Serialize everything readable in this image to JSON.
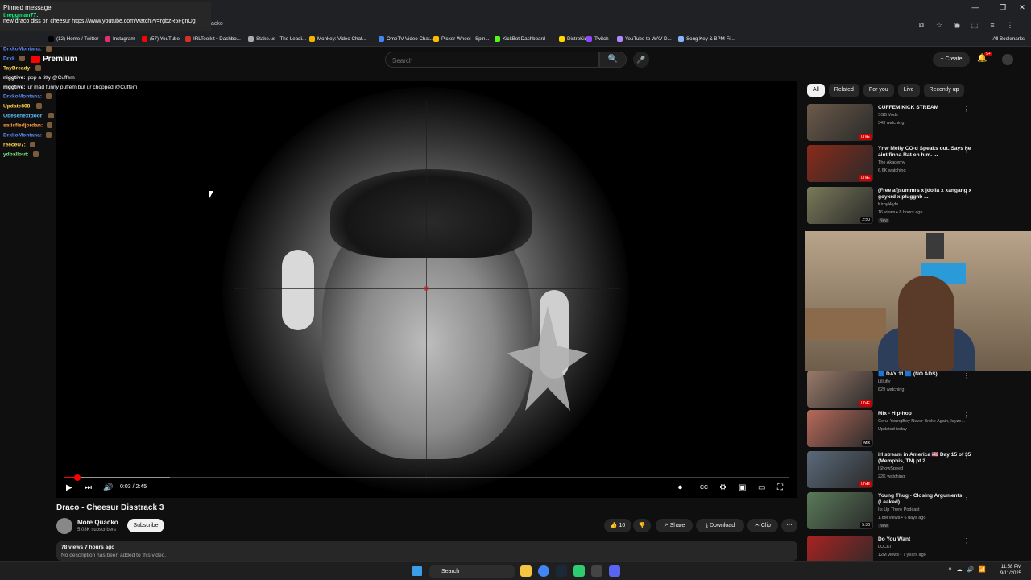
{
  "browser": {
    "tab_title_fragment": "acko",
    "window_controls": [
      "—",
      "❐",
      "✕"
    ],
    "toolbar_icons": [
      "⧉",
      "☆",
      "◉",
      "⬚",
      "≡",
      "⋮"
    ],
    "bookmarks": [
      {
        "label": "(12) Home / Twitter",
        "color": "#000000"
      },
      {
        "label": "Instagram",
        "color": "#e1306c"
      },
      {
        "label": "(57) YouTube",
        "color": "#ff0000"
      },
      {
        "label": "IRLToolkit • Dashbo...",
        "color": "#d93025"
      },
      {
        "label": "Stake.us - The Leadi...",
        "color": "#aaaaaa"
      },
      {
        "label": "Monkey: Video Chat...",
        "color": "#f4b400"
      },
      {
        "label": "OmeTV Video Chat...",
        "color": "#4285f4"
      },
      {
        "label": "Picker Wheel - Spin...",
        "color": "#fbbc04"
      },
      {
        "label": "KickBot Dashboard",
        "color": "#53fc18"
      },
      {
        "label": "DistroKid",
        "color": "#ffd600"
      },
      {
        "label": "Twitch",
        "color": "#9146ff"
      },
      {
        "label": "YouTube to WAV D...",
        "color": "#b388ff"
      },
      {
        "label": "Song Key & BPM Fi...",
        "color": "#8ab4f8"
      }
    ],
    "all_bookmarks": "All Bookmarks"
  },
  "yt_header": {
    "logo_text": "Premium",
    "search_placeholder": "Search",
    "search_icon": "🔍",
    "mic_icon": "🎤",
    "create_label": "+ Create",
    "bell_icon": "🔔",
    "notif_count": "9+"
  },
  "chat": {
    "pinned_header": "Pinned message",
    "pinned_user": "theggman77:",
    "pinned_text": "new draco diss on cheesur https://www.youtube.com/watch?v=rgbzR5FgnOg",
    "messages": [
      {
        "user": "DrxkoMontana:",
        "text": "",
        "color": "#5b8cff"
      },
      {
        "user": "Drxk",
        "text": "",
        "color": "#5b8cff"
      },
      {
        "user": "TayBready:",
        "text": "",
        "color": "#ffd24a"
      },
      {
        "user": "niggtive:",
        "text": "pop a titty @Cuffem",
        "color": "#ffffff"
      },
      {
        "user": "niggtive:",
        "text": "ur mad funny puffem but ur chopped @Cuffem",
        "color": "#ffffff"
      },
      {
        "user": "DrxkoMontana:",
        "text": "",
        "color": "#5b8cff"
      },
      {
        "user": "Update808:",
        "text": "",
        "color": "#ffd24a"
      },
      {
        "user": "Obesenextdoor:",
        "text": "",
        "color": "#5bc0ff"
      },
      {
        "user": "satisfiedjordan:",
        "text": "",
        "color": "#ff9f40"
      },
      {
        "user": "DrxkoMontana:",
        "text": "",
        "color": "#5b8cff"
      },
      {
        "user": "reeceU7:",
        "text": "",
        "color": "#ffd24a"
      },
      {
        "user": "ydballout:",
        "text": "",
        "color": "#7ee87e"
      }
    ]
  },
  "player": {
    "time_display": "0:03 / 2:45",
    "progress_fraction": 0.018,
    "buffer_fraction": 0.145,
    "play_icon": "▶",
    "next_icon": "⏭",
    "volume_icon": "🔊",
    "autoplay_icon": "⏺",
    "cc_icon": "CC",
    "settings_icon": "⚙",
    "miniplayer_icon": "▣",
    "theater_icon": "▭",
    "fullscreen_icon": "⛶"
  },
  "video": {
    "title": "Draco - Cheesur Disstrack 3",
    "channel": "More Quacko",
    "subscribers": "5.03K subscribers",
    "subscribe_label": "Subscribe",
    "likes": "10",
    "share_label": "Share",
    "download_label": "Download",
    "clip_label": "Clip",
    "more_icon": "⋯",
    "views_date": "78 views  7 hours ago",
    "description": "No description has been added to this video."
  },
  "filters": {
    "chips": [
      "All",
      "Related",
      "For you",
      "Live",
      "Recently up"
    ],
    "arrow_icon": "›"
  },
  "recommendations": [
    {
      "title": "CUFFEM KICK STREAM",
      "channel": "SSB Vods",
      "stats": "343 watching",
      "badge": "LIVE",
      "badge_type": "live",
      "thumb": "#6b5a4a",
      "new": ""
    },
    {
      "title": "Ynw Melly CO-d Speaks out. Says he aint finna Rat on him. ...",
      "channel": "The Akademy",
      "stats": "6.6K watching",
      "badge": "LIVE",
      "badge_type": "live",
      "thumb": "#8a2a1a",
      "new": ""
    },
    {
      "title": "(Free af)summrs x jdolla x xangang x goyxrd x pluggnb ...",
      "channel": "Kirbyl4lyfe",
      "stats": "16 views • 8 hours ago",
      "badge": "2:50",
      "badge_type": "time",
      "thumb": "#7a7a5a",
      "new": "New"
    },
    {
      "title": "🟦 DAY 11 🟦 (NO ADS)",
      "channel": "Lilluffy",
      "stats": "829 watching",
      "badge": "LIVE",
      "badge_type": "live",
      "thumb": "#9a7a6a",
      "new": ""
    },
    {
      "title": "Mix - Hip-hop",
      "channel": "Ceru, YoungBoy Never Broke Again, Iayze...",
      "stats": "Updated today",
      "badge": "Mix",
      "badge_type": "time",
      "thumb": "#b86a5a",
      "new": ""
    },
    {
      "title": "irl stream in America 🇺🇸 Day 15 of 35 (Memphis, TN) pt 2",
      "channel": "IShowSpeed",
      "stats": "22K watching",
      "badge": "LIVE",
      "badge_type": "live",
      "thumb": "#5a6a7a",
      "new": ""
    },
    {
      "title": "Young Thug - Closing Arguments (Leaked)",
      "channel": "Its Up There Podcast",
      "stats": "1.8M views • 6 days ago",
      "badge": "5:30",
      "badge_type": "time",
      "thumb": "#5a7a5a",
      "new": "New"
    },
    {
      "title": "Do You Want",
      "channel": "LUCKI",
      "stats": "12M views • 7 years ago",
      "badge": "",
      "badge_type": "time",
      "thumb": "#aa2222",
      "new": ""
    }
  ],
  "taskbar": {
    "search_label": "Search",
    "tray_icons": [
      "˄",
      "☁",
      "🔊",
      "📶"
    ],
    "time": "11:58 PM",
    "date": "9/11/2025"
  }
}
